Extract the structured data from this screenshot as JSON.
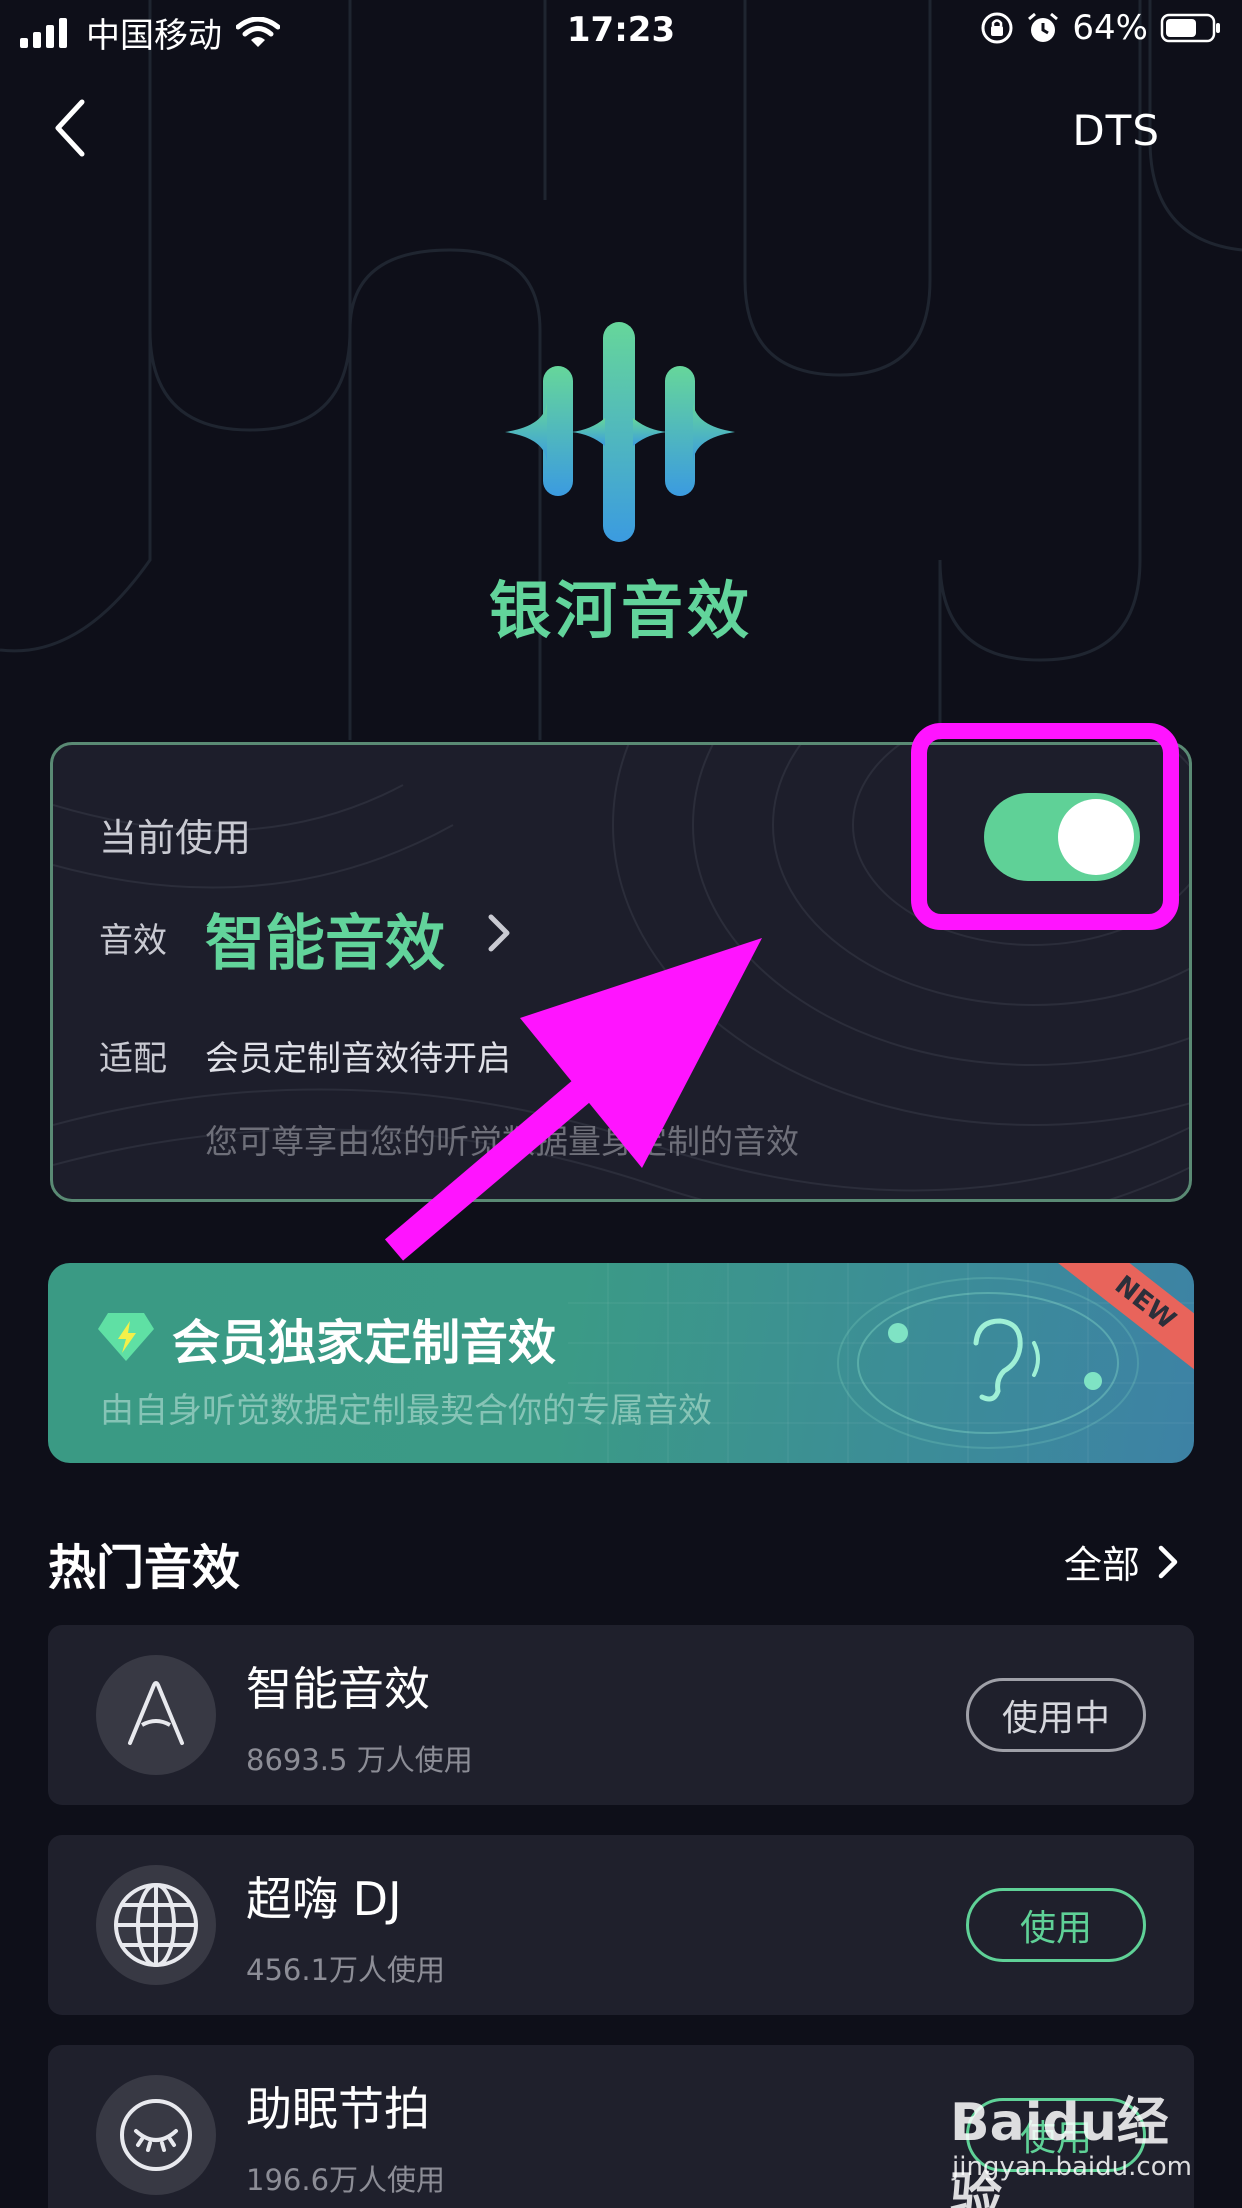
{
  "status_bar": {
    "carrier": "中国移动",
    "time": "17:23",
    "battery": "64%"
  },
  "nav": {
    "right_label": "DTS"
  },
  "logo": {
    "text": "银河音效"
  },
  "current": {
    "label": "当前使用",
    "effect_key": "音效",
    "effect_value": "智能音效",
    "adapt_key": "适配",
    "adapt_value": "会员定制音效待开启",
    "description": "您可尊享由您的听觉数据量身定制的音效",
    "toggle_on": true
  },
  "vip_banner": {
    "title": "会员独家定制音效",
    "subtitle": "由自身听觉数据定制最契合你的专属音效",
    "badge": "NEW"
  },
  "hot": {
    "title": "热门音效",
    "all_label": "全部",
    "items": [
      {
        "name": "智能音效",
        "count": "8693.5 万人使用",
        "button": "使用中",
        "icon": "letter-a-icon"
      },
      {
        "name": "超嗨 DJ",
        "count": "456.1万人使用",
        "button": "使用",
        "icon": "globe-icon"
      },
      {
        "name": "助眠节拍",
        "count": "196.6万人使用",
        "button": "使用",
        "icon": "sleep-eye-icon"
      }
    ]
  },
  "watermark": {
    "text": "Baidu经验",
    "url": "jingyan.baidu.com"
  },
  "colors": {
    "accent_green": "#5fd197",
    "highlight_magenta": "#ff14ff",
    "background": "#0e0f19"
  }
}
